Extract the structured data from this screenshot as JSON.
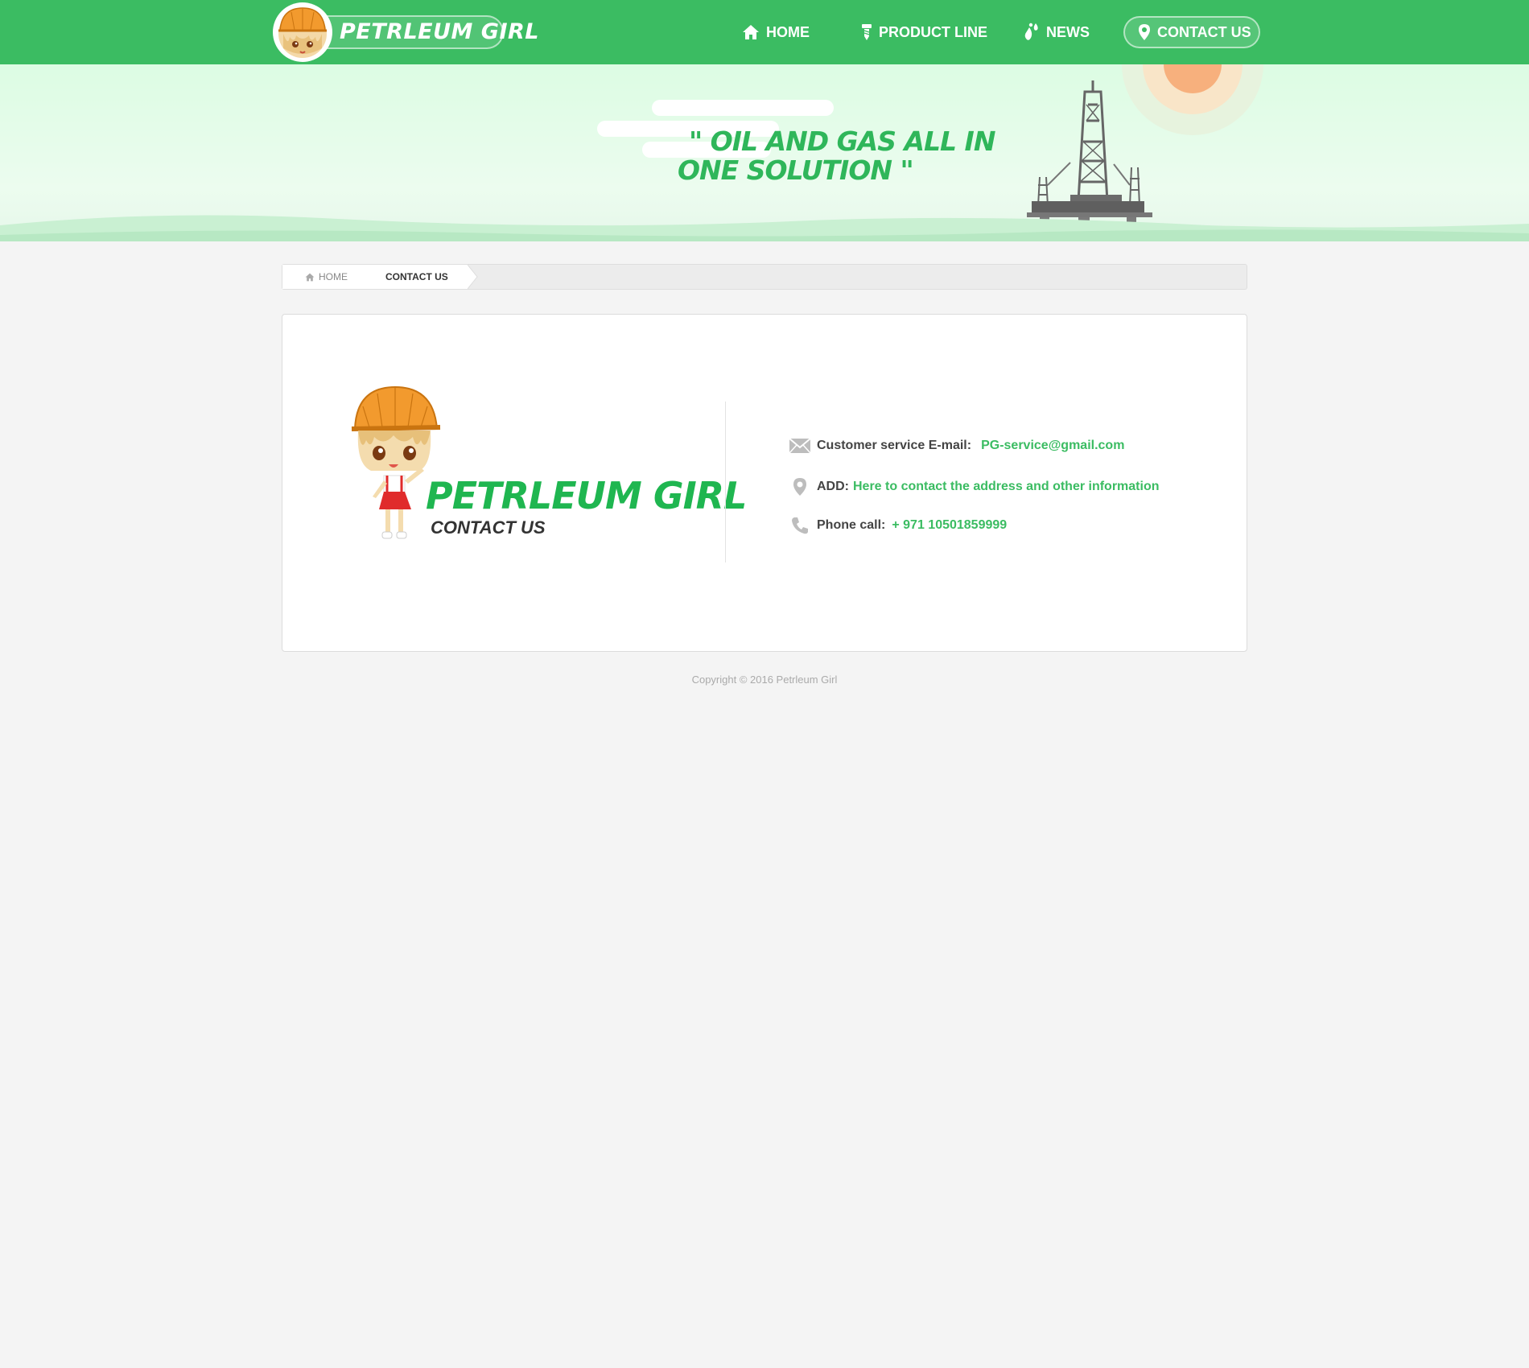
{
  "header": {
    "logo_text": "PETRLEUM GIRL",
    "nav": [
      {
        "label": "HOME",
        "icon": "home-icon"
      },
      {
        "label": "PRODUCT LINE",
        "icon": "screw-icon"
      },
      {
        "label": "NEWS",
        "icon": "droplets-icon"
      },
      {
        "label": "CONTACT US",
        "icon": "location-pin-icon",
        "active": true
      }
    ]
  },
  "banner": {
    "slogan_line1": "\" OIL AND GAS ALL IN",
    "slogan_line2": "ONE SOLUTION \""
  },
  "breadcrumb": {
    "home": "HOME",
    "current": "CONTACT US"
  },
  "contact": {
    "brand": "PETRLEUM GIRL",
    "subtitle": "CONTACT US",
    "email_label": "Customer service E-mail:",
    "email_value": "PG-service@gmail.com",
    "address_label": "ADD:",
    "address_value": "Here to contact the address and other information",
    "phone_label": "Phone call:",
    "phone_value": "+ 971 10501859999"
  },
  "footer": {
    "copyright": "Copyright  © 2016 Petrleum Girl"
  },
  "colors": {
    "brand_green": "#3bbc62",
    "banner_bg": "#dcfce3",
    "page_bg": "#f4f4f4"
  }
}
